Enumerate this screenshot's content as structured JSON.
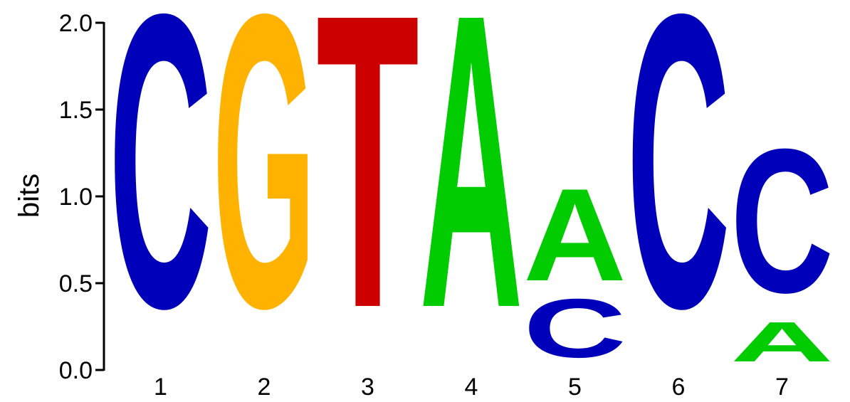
{
  "chart_data": {
    "type": "sequence-logo",
    "ylabel": "bits",
    "ylim": [
      0,
      2
    ],
    "yticks": [
      "0.0",
      "0.5",
      "1.0",
      "1.5",
      "2.0"
    ],
    "positions": [
      "1",
      "2",
      "3",
      "4",
      "5",
      "6",
      "7"
    ],
    "columns": [
      {
        "position": "1",
        "stack": [
          {
            "letter": "C",
            "bits": 2.0
          }
        ]
      },
      {
        "position": "2",
        "stack": [
          {
            "letter": "G",
            "bits": 2.0
          }
        ]
      },
      {
        "position": "3",
        "stack": [
          {
            "letter": "T",
            "bits": 2.0
          }
        ]
      },
      {
        "position": "4",
        "stack": [
          {
            "letter": "A",
            "bits": 2.0
          }
        ]
      },
      {
        "position": "5",
        "stack": [
          {
            "letter": "C",
            "bits": 0.4
          },
          {
            "letter": "A",
            "bits": 0.63
          }
        ]
      },
      {
        "position": "6",
        "stack": [
          {
            "letter": "C",
            "bits": 2.0
          }
        ]
      },
      {
        "position": "7",
        "stack": [
          {
            "letter": "A",
            "bits": 0.27
          },
          {
            "letter": "C",
            "bits": 0.98
          }
        ]
      }
    ],
    "colors": {
      "A": "#00cc00",
      "C": "#0000bb",
      "G": "#ffb300",
      "T": "#cc0000"
    },
    "grid": false
  }
}
